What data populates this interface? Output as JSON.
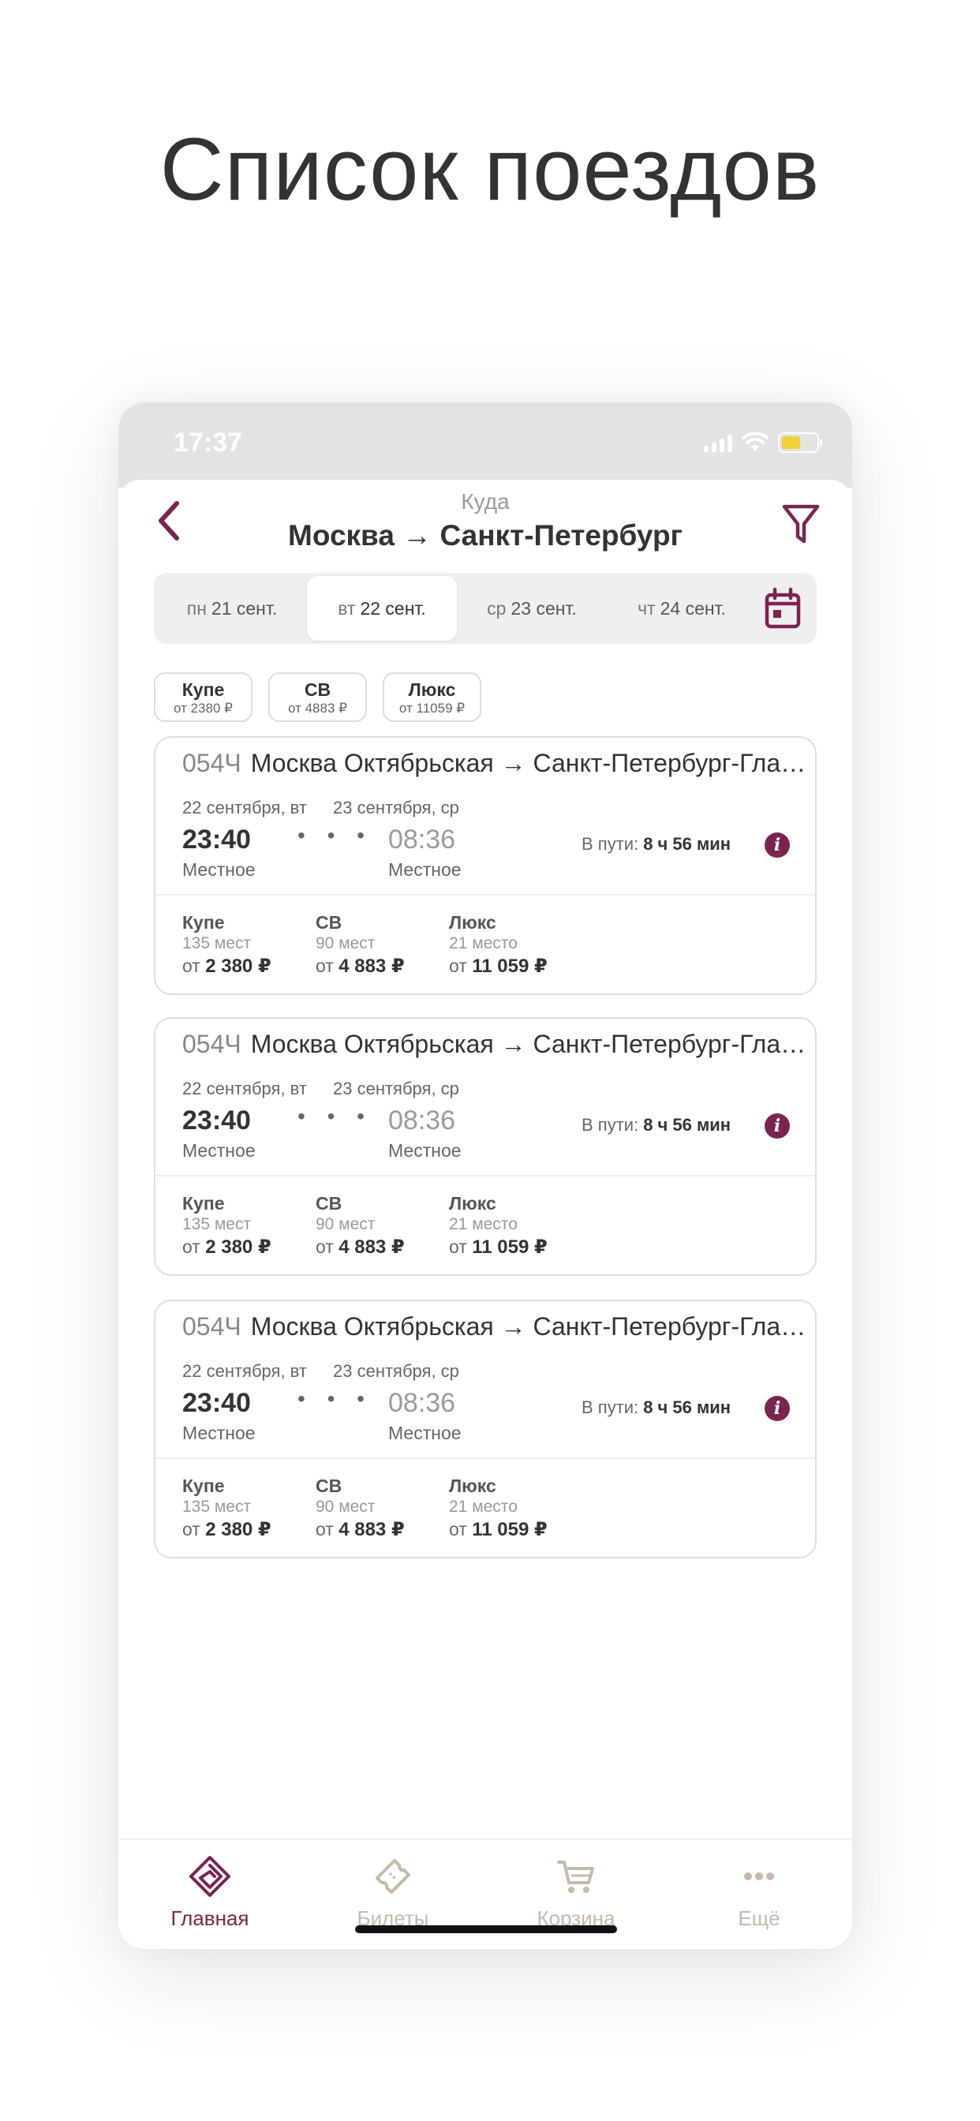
{
  "page_title": "Список поездов",
  "status": {
    "time": "17:37"
  },
  "header": {
    "label": "Куда",
    "route": "Москва → Санкт-Петербург"
  },
  "dates": [
    {
      "dow": "пн",
      "date": "21 сент."
    },
    {
      "dow": "вт",
      "date": "22 сент.",
      "active": true
    },
    {
      "dow": "ср",
      "date": "23 сент."
    },
    {
      "dow": "чт",
      "date": "24 сент."
    }
  ],
  "chips": [
    {
      "name": "Купе",
      "price": "от 2380 ₽"
    },
    {
      "name": "СВ",
      "price": "от 4883 ₽"
    },
    {
      "name": "Люкс",
      "price": "от 11059 ₽"
    }
  ],
  "trains": [
    {
      "number": "054Ч",
      "route": "Москва Октябрьская → Санкт-Петербург-Гла…",
      "dep_date": "22 сентября, вт",
      "arr_date": "23 сентября, ср",
      "dep_time": "23:40",
      "arr_time": "08:36",
      "dots": "• • •",
      "dep_tz": "Местное",
      "arr_tz": "Местное",
      "duration_label": "В пути:",
      "duration": "8 ч 56 мин",
      "info": "i",
      "classes": [
        {
          "name": "Купе",
          "seats": "135 мест",
          "from": "от",
          "price": "2 380 ₽"
        },
        {
          "name": "СВ",
          "seats": "90 мест",
          "from": "от",
          "price": "4 883 ₽"
        },
        {
          "name": "Люкс",
          "seats": "21 место",
          "from": "от",
          "price": "11 059 ₽"
        }
      ]
    },
    {
      "number": "054Ч",
      "route": "Москва Октябрьская → Санкт-Петербург-Гла…",
      "dep_date": "22 сентября, вт",
      "arr_date": "23 сентября, ср",
      "dep_time": "23:40",
      "arr_time": "08:36",
      "dots": "• • •",
      "dep_tz": "Местное",
      "arr_tz": "Местное",
      "duration_label": "В пути:",
      "duration": "8 ч 56 мин",
      "info": "i",
      "classes": [
        {
          "name": "Купе",
          "seats": "135 мест",
          "from": "от",
          "price": "2 380 ₽"
        },
        {
          "name": "СВ",
          "seats": "90 мест",
          "from": "от",
          "price": "4 883 ₽"
        },
        {
          "name": "Люкс",
          "seats": "21 место",
          "from": "от",
          "price": "11 059 ₽"
        }
      ]
    },
    {
      "number": "054Ч",
      "route": "Москва Октябрьская → Санкт-Петербург-Гла…",
      "dep_date": "22 сентября, вт",
      "arr_date": "23 сентября, ср",
      "dep_time": "23:40",
      "arr_time": "08:36",
      "dots": "• • •",
      "dep_tz": "Местное",
      "arr_tz": "Местное",
      "duration_label": "В пути:",
      "duration": "8 ч 56 мин",
      "info": "i",
      "classes": [
        {
          "name": "Купе",
          "seats": "135 мест",
          "from": "от",
          "price": "2 380 ₽"
        },
        {
          "name": "СВ",
          "seats": "90 мест",
          "from": "от",
          "price": "4 883 ₽"
        },
        {
          "name": "Люкс",
          "seats": "21 место",
          "from": "от",
          "price": "11 059 ₽"
        }
      ]
    }
  ],
  "tabs": [
    {
      "label": "Главная",
      "icon": "home-logo-icon",
      "active": true
    },
    {
      "label": "Билеты",
      "icon": "ticket-icon"
    },
    {
      "label": "Корзина",
      "icon": "cart-icon"
    },
    {
      "label": "Ещё",
      "icon": "more-icon"
    }
  ],
  "colors": {
    "accent": "#7b2352",
    "inactive_tab": "#c7b9a8",
    "battery": "#f2d13a"
  }
}
